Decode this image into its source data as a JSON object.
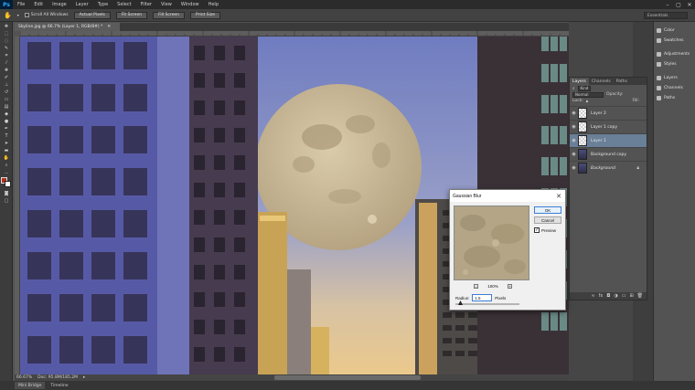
{
  "app": {
    "logo": "Ps"
  },
  "menu": [
    "File",
    "Edit",
    "Image",
    "Layer",
    "Type",
    "Select",
    "Filter",
    "View",
    "Window",
    "Help"
  ],
  "window_controls": [
    "–",
    "▢",
    "✕"
  ],
  "options_bar": {
    "scroll_all_windows": "Scroll All Windows",
    "buttons": [
      "Actual Pixels",
      "Fit Screen",
      "Fill Screen",
      "Print Size"
    ],
    "workspace": "Essentials"
  },
  "document": {
    "tab_title": "Skyline.jpg @ 66.7% (Layer 1, RGB/8#) *"
  },
  "status": {
    "zoom": "66.67%",
    "doc_info": "Doc: 95.8M/185.2M"
  },
  "bottom_tabs": [
    "Mini Bridge",
    "Timeline"
  ],
  "panel_list": {
    "group1": [
      "Color",
      "Swatches"
    ],
    "group2": [
      "Adjustments",
      "Styles"
    ],
    "group3": [
      "Layers",
      "Channels",
      "Paths"
    ]
  },
  "layers_panel": {
    "tabs": [
      "Layers",
      "Channels",
      "Paths"
    ],
    "kind_filter": "Kind",
    "blend_mode": "Normal",
    "opacity_label": "Opacity:",
    "lock_label": "Lock:",
    "fill_label": "Fill:",
    "layers": [
      {
        "name": "Layer 2",
        "thumb": "checker",
        "selected": false,
        "italic": false,
        "locked": false
      },
      {
        "name": "Layer 1 copy",
        "thumb": "checker",
        "selected": false,
        "italic": false,
        "locked": false
      },
      {
        "name": "Layer 1",
        "thumb": "checker",
        "selected": true,
        "italic": false,
        "locked": false
      },
      {
        "name": "Background copy",
        "thumb": "photo",
        "selected": false,
        "italic": false,
        "locked": false
      },
      {
        "name": "Background",
        "thumb": "photo",
        "selected": false,
        "italic": true,
        "locked": true
      }
    ]
  },
  "gaussian_blur": {
    "title": "Gaussian Blur",
    "ok": "OK",
    "cancel": "Cancel",
    "preview_label": "Preview",
    "preview_checked": true,
    "zoom": "100%",
    "zoom_out": "–",
    "zoom_in": "+",
    "radius_label": "Radius:",
    "radius_value": "1.5",
    "radius_unit": "Pixels"
  },
  "colors": {
    "accent": "#31a8ff",
    "sky_top": "#7a86c4",
    "sky_bottom": "#e4c48a",
    "moon": "#c8b896",
    "selected_layer": "#6a7f98"
  }
}
